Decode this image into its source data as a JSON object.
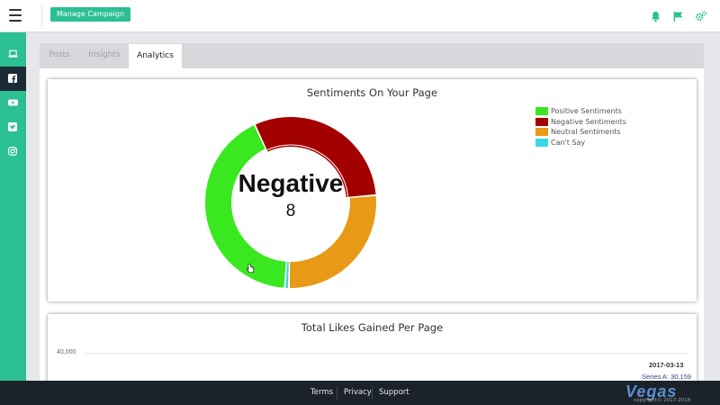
{
  "header": {
    "manage_campaign_label": "Manage Campaign",
    "icons": [
      "menu-icon",
      "bell-icon",
      "flag-icon",
      "cogs-icon"
    ]
  },
  "sidebar": {
    "items": [
      {
        "icon": "laptop-icon",
        "active": false
      },
      {
        "icon": "facebook-icon",
        "active": true
      },
      {
        "icon": "youtube-icon",
        "active": false
      },
      {
        "icon": "twitter-icon",
        "active": false
      },
      {
        "icon": "instagram-icon",
        "active": false
      }
    ]
  },
  "tabs": [
    {
      "label": "Posts",
      "active": false
    },
    {
      "label": "Insights",
      "active": false
    },
    {
      "label": "Analytics",
      "active": true
    }
  ],
  "sentiment_card": {
    "title": "Sentiments On Your Page",
    "center_label": "Negative",
    "center_value": "8",
    "legend": [
      {
        "label": "Positive Sentiments",
        "color": "#39e81f"
      },
      {
        "label": "Negative Sentiments",
        "color": "#a30000"
      },
      {
        "label": "Neutral Sentiments",
        "color": "#e89a17"
      },
      {
        "label": "Can't Say",
        "color": "#38d8e8"
      }
    ]
  },
  "likes_card": {
    "title": "Total Likes Gained Per Page",
    "ytick": "40,000",
    "tooltip_date": "2017-03-13",
    "tooltip_series": "Series A: 30,159"
  },
  "chart_data": [
    {
      "type": "pie",
      "title": "Sentiments On Your Page",
      "categories": [
        "Positive Sentiments",
        "Negative Sentiments",
        "Neutral Sentiments",
        "Can't Say"
      ],
      "values": [
        11,
        8,
        7,
        0.2
      ],
      "colors": [
        "#39e81f",
        "#a30000",
        "#e89a17",
        "#38d8e8"
      ],
      "legend": "top-right",
      "highlighted": "Negative Sentiments"
    },
    {
      "type": "line",
      "title": "Total Likes Gained Per Page",
      "yticks": [
        40000
      ],
      "tooltip": {
        "x": "2017-03-13",
        "series": "Series A",
        "y": 30159
      }
    }
  ],
  "footer": {
    "links": [
      "Terms",
      "Privacy",
      "Support"
    ],
    "brand": "Vegas",
    "copyright": "copyright© 2017-2018"
  }
}
